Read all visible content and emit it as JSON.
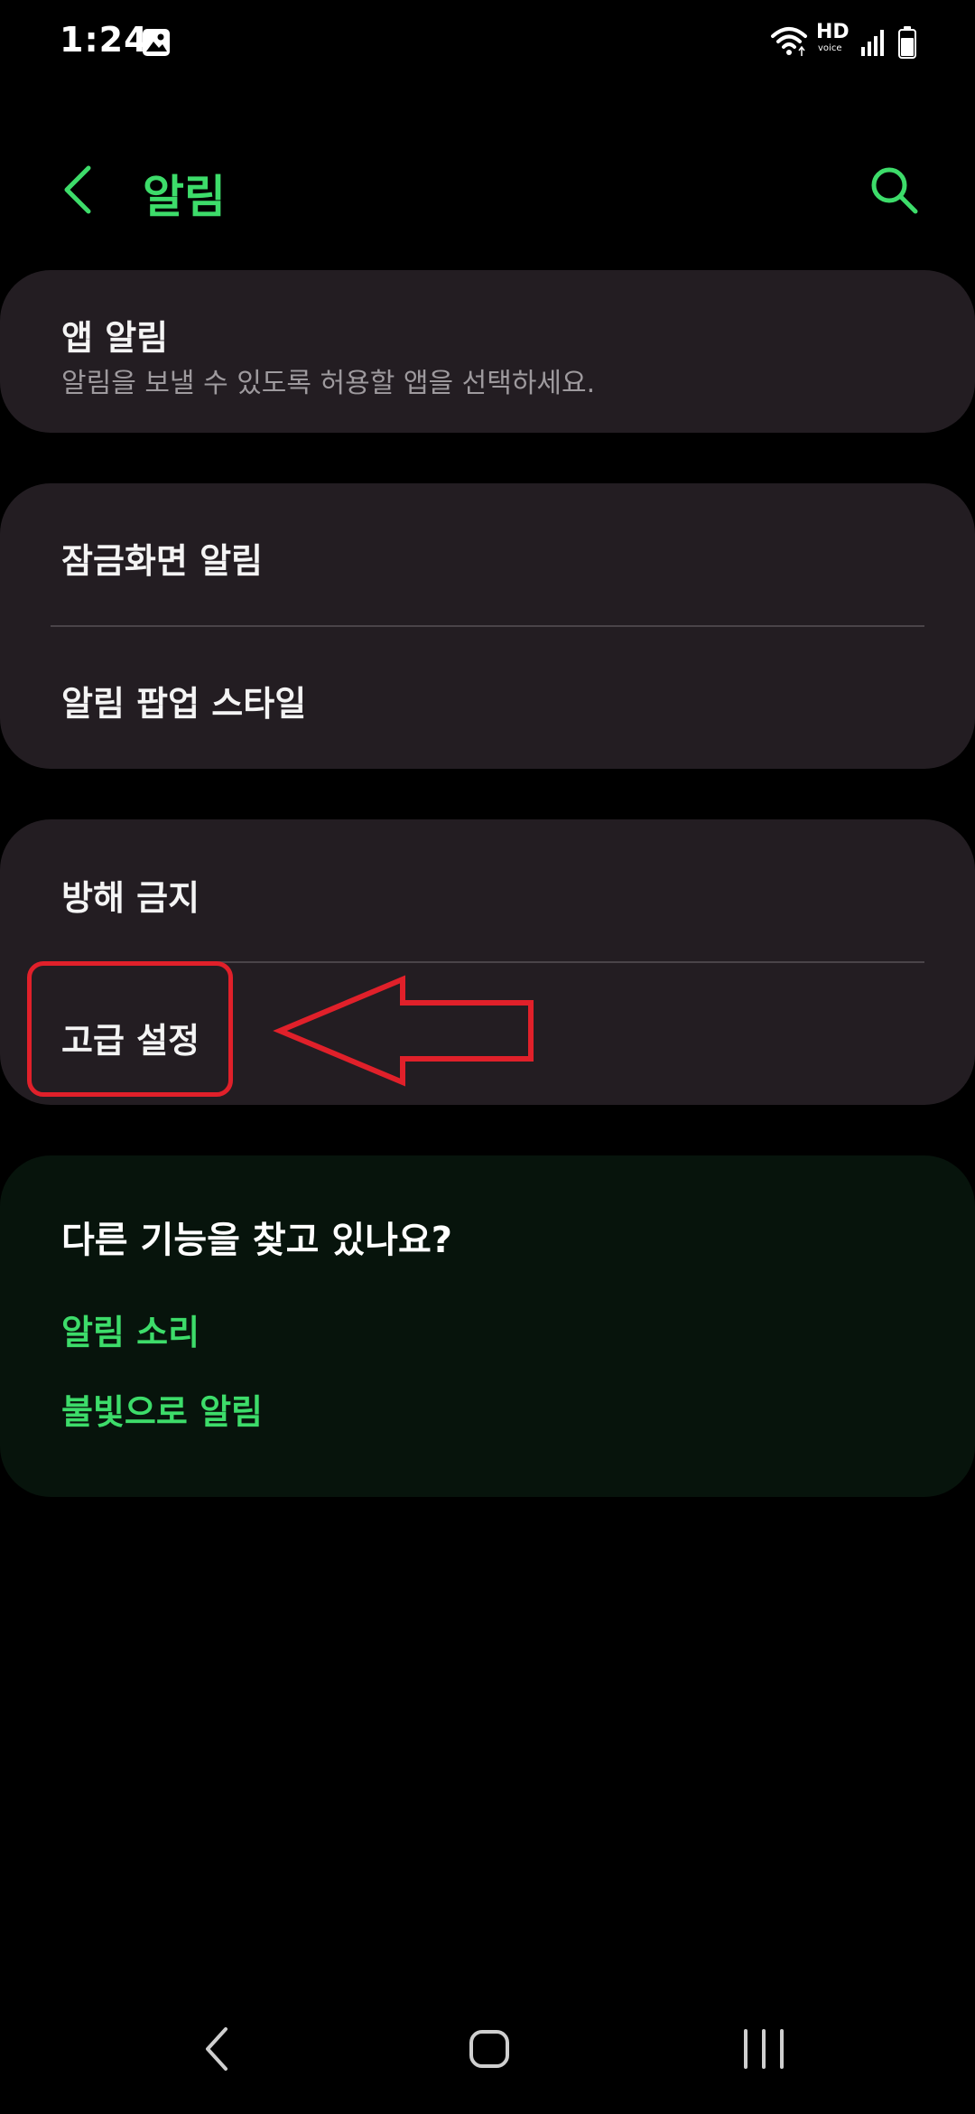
{
  "status_bar": {
    "time": "1:24",
    "hd_label": "HD",
    "voice_label": "voice",
    "icons": [
      "gallery-icon",
      "wifi-icon",
      "signal-icon",
      "battery-icon"
    ]
  },
  "header": {
    "title": "알림",
    "back_icon": "chevron-left-icon",
    "search_icon": "search-icon"
  },
  "sections": {
    "app_notifications": {
      "title": "앱 알림",
      "subtitle": "알림을 보낼 수 있도록 허용할 앱을 선택하세요."
    },
    "lock_screen": {
      "title": "잠금화면 알림"
    },
    "popup_style": {
      "title": "알림 팝업 스타일"
    },
    "do_not_disturb": {
      "title": "방해 금지"
    },
    "advanced": {
      "title": "고급 설정"
    }
  },
  "suggestions": {
    "heading": "다른 기능을 찾고 있나요?",
    "links": [
      "알림 소리",
      "불빛으로 알림"
    ]
  },
  "colors": {
    "accent": "#3ddc6a",
    "card_bg": "#231d22",
    "suggest_bg": "#07140c",
    "annotation_red": "#e0202a"
  },
  "nav_bar": {
    "icons": [
      "back-icon",
      "home-icon",
      "recents-icon"
    ]
  }
}
